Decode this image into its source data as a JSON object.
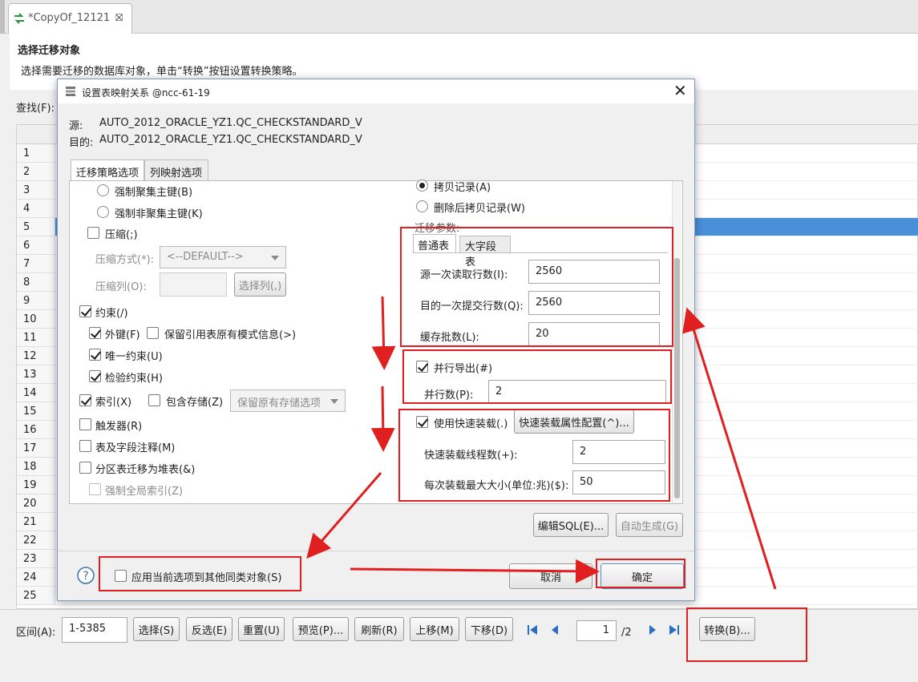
{
  "editor": {
    "tab_title": "*CopyOf_12121"
  },
  "header": {
    "title": "选择迁移对象",
    "description": "选择需要迁移的数据库对象，单击“转换”按钮设置转换策略。"
  },
  "search": {
    "label": "查找(F):"
  },
  "table": {
    "row_numbers": [
      "1",
      "2",
      "3",
      "4",
      "5",
      "6",
      "7",
      "8",
      "9",
      "10",
      "11",
      "12",
      "13",
      "14",
      "15",
      "16",
      "17",
      "18",
      "19",
      "20",
      "21",
      "22",
      "23",
      "24",
      "25"
    ],
    "selected_row": "5"
  },
  "bottom_bar": {
    "range_label": "区间(A):",
    "range_value": "1-5385",
    "select": "选择(S)",
    "invert": "反选(E)",
    "reset": "重置(U)",
    "preview": "预览(P)...",
    "refresh": "刷新(R)",
    "move_up": "上移(M)",
    "move_down": "下移(D)",
    "page_value": "1",
    "page_total": "/2",
    "convert": "转换(B)..."
  },
  "dialog": {
    "title": "设置表映射关系 @ncc-61-19",
    "source_label": "源:",
    "source_value": "AUTO_2012_ORACLE_YZ1.QC_CHECKSTANDARD_V",
    "target_label": "目的:",
    "target_value": "AUTO_2012_ORACLE_YZ1.QC_CHECKSTANDARD_V",
    "tabs": [
      "迁移策略选项",
      "列映射选项"
    ],
    "left": {
      "force_clustered_pk": "强制聚集主键(B)",
      "force_nonclustered_pk": "强制非聚集主键(K)",
      "compress": "压缩(;)",
      "compress_mode_label": "压缩方式(*):",
      "compress_mode_value": "<--DEFAULT-->",
      "compress_cols_label": "压缩列(O):",
      "select_cols": "选择列(,)",
      "constraint": "约束(/)",
      "foreign_key": "外键(F)",
      "keep_ref_schema": "保留引用表原有模式信息(>)",
      "unique": "唯一约束(U)",
      "check": "检验约束(H)",
      "index": "索引(X)",
      "include_storage": "包含存储(Z)",
      "storage_option": "保留原有存储选项",
      "trigger": "触发器(R)",
      "comments": "表及字段注释(M)",
      "partition_heap": "分区表迁移为堆表(&)",
      "force_global_index": "强制全局索引(Z)"
    },
    "right": {
      "copy_records": "拷贝记录(A)",
      "delete_then_copy": "删除后拷贝记录(W)",
      "params_label": "迁移参数:",
      "subtabs": [
        "普通表",
        "大字段表"
      ],
      "read_rows_label": "源一次读取行数(I):",
      "read_rows_value": "2560",
      "commit_rows_label": "目的一次提交行数(Q):",
      "commit_rows_value": "2560",
      "cache_batches_label": "缓存批数(L):",
      "cache_batches_value": "20",
      "parallel_export": "并行导出(#)",
      "parallel_label": "并行数(P):",
      "parallel_value": "2",
      "fast_load": "使用快速装载(.)",
      "fast_load_config": "快速装载属性配置(^)...",
      "fast_threads_label": "快速装载线程数(+):",
      "fast_threads_value": "2",
      "fast_max_label": "每次装载最大大小(单位:兆)($):",
      "fast_max_value": "50"
    },
    "edit_sql": "编辑SQL(E)...",
    "auto_gen": "自动生成(G)",
    "apply_same": "应用当前选项到其他同类对象(S)",
    "cancel": "取消",
    "ok": "确定"
  },
  "colors": {
    "annotation_red": "#e02020",
    "selection_blue": "#4a90d9"
  }
}
